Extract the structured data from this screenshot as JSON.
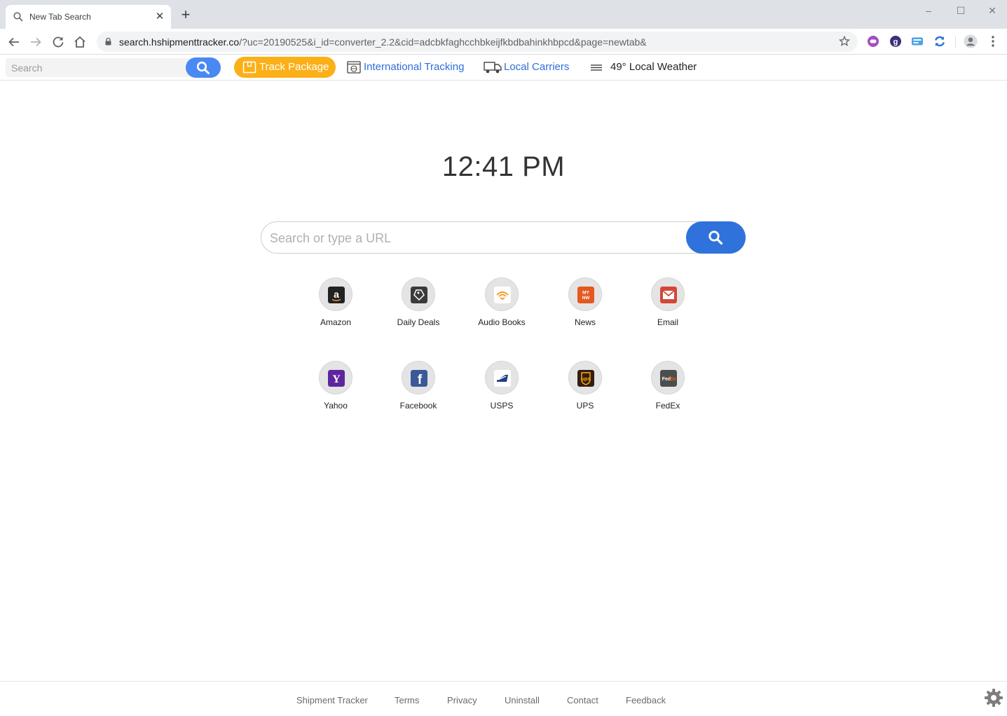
{
  "browser": {
    "tab_title": "New Tab Search",
    "tab_close": "✕",
    "new_tab": "+",
    "window_controls": {
      "minimize": "–",
      "maximize": "☐",
      "close": "✕"
    },
    "url_host": "search.hshipmenttracker.co",
    "url_rest": "/?uc=20190525&i_id=converter_2.2&cid=adcbkfaghcchbkeijfkbdbahinkhbpcd&page=newtab&"
  },
  "extbar": {
    "search_placeholder": "Search",
    "track_package": "Track Package",
    "international_tracking": "International Tracking",
    "local_carriers": "Local Carriers",
    "weather": "49° Local Weather",
    "accent_color": "#fbb017",
    "link_color": "#2f6ed8"
  },
  "main": {
    "clock": "12:41 PM",
    "search_placeholder": "Search or type a URL",
    "tiles": [
      {
        "label": "Amazon",
        "icon": "amazon-icon"
      },
      {
        "label": "Daily Deals",
        "icon": "tag-icon"
      },
      {
        "label": "Audio Books",
        "icon": "audible-icon"
      },
      {
        "label": "News",
        "icon": "news-icon"
      },
      {
        "label": "Email",
        "icon": "gmail-icon"
      },
      {
        "label": "Yahoo",
        "icon": "yahoo-icon"
      },
      {
        "label": "Facebook",
        "icon": "facebook-icon"
      },
      {
        "label": "USPS",
        "icon": "usps-icon"
      },
      {
        "label": "UPS",
        "icon": "ups-icon"
      },
      {
        "label": "FedEx",
        "icon": "fedex-icon"
      }
    ]
  },
  "footer": {
    "links": [
      "Shipment Tracker",
      "Terms",
      "Privacy",
      "Uninstall",
      "Contact",
      "Feedback"
    ]
  }
}
